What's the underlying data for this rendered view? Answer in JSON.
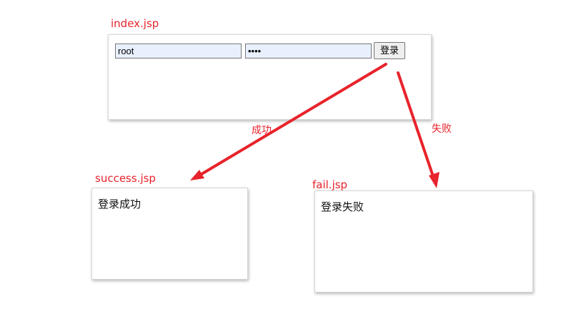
{
  "index_page": {
    "label": "index.jsp",
    "username_value": "root",
    "password_value": "••••",
    "login_button": "登录"
  },
  "success_page": {
    "label": "success.jsp",
    "message": "登录成功"
  },
  "fail_page": {
    "label": "fail.jsp",
    "message": "登录失败"
  },
  "arrows": {
    "success_label": "成功",
    "fail_label": "失败"
  },
  "colors": {
    "accent": "#e8232b",
    "input_fill": "#e8f0fe"
  }
}
